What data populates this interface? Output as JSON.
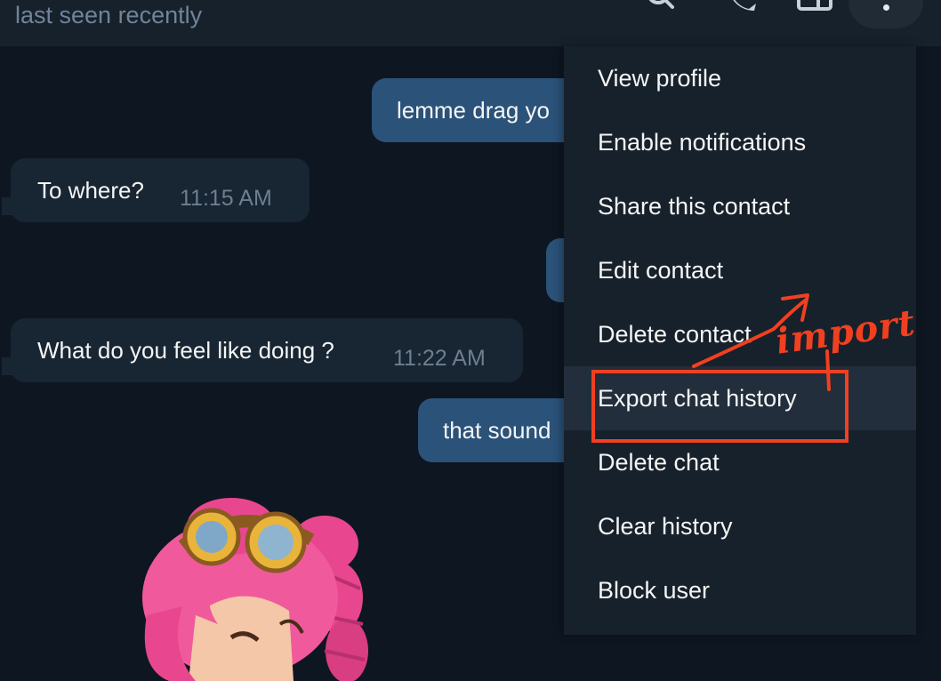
{
  "header": {
    "status": "last seen recently",
    "icons": [
      "search-icon",
      "phone-icon",
      "sidebar-icon",
      "more-icon"
    ]
  },
  "messages": [
    {
      "direction": "out",
      "text": "lemme drag yo"
    },
    {
      "direction": "in",
      "text": "To where?",
      "time": "11:15 AM"
    },
    {
      "direction": "out",
      "text": ""
    },
    {
      "direction": "in",
      "text": "What do you feel like doing ?",
      "time": "11:22 AM"
    },
    {
      "direction": "out",
      "text": "that sound"
    }
  ],
  "menu": {
    "items": [
      {
        "label": "View profile"
      },
      {
        "label": "Enable notifications"
      },
      {
        "label": "Share this contact"
      },
      {
        "label": "Edit contact"
      },
      {
        "label": "Delete contact"
      },
      {
        "label": "Export chat history"
      },
      {
        "label": "Delete chat"
      },
      {
        "label": "Clear history"
      },
      {
        "label": "Block user"
      }
    ]
  },
  "annotation": {
    "text": "import",
    "color": "#f04020"
  },
  "colors": {
    "background": "#0e1621",
    "panel": "#17212b",
    "incoming_bubble": "#182533",
    "outgoing_bubble": "#2b5278",
    "muted_text": "#708499"
  }
}
